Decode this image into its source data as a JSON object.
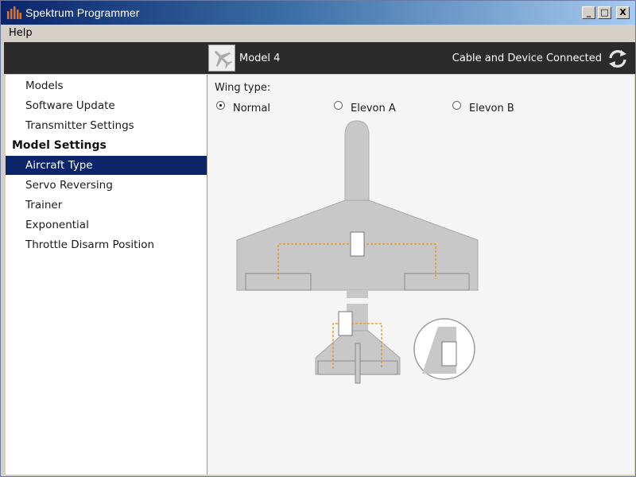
{
  "window": {
    "title": "Spektrum Programmer",
    "controls": {
      "minimize": "_",
      "maximize": "□",
      "close": "X"
    }
  },
  "menu": {
    "help": "Help"
  },
  "header": {
    "model_name": "Model 4",
    "status": "Cable and Device Connected"
  },
  "sidebar": {
    "items_top": [
      "Models",
      "Software Update",
      "Transmitter Settings"
    ],
    "section_title": "Model Settings",
    "items_model": [
      "Aircraft Type",
      "Servo Reversing",
      "Trainer",
      "Exponential",
      "Throttle Disarm Position"
    ],
    "selected": "Aircraft Type"
  },
  "main": {
    "wing_type_label": "Wing type:",
    "wing_options": [
      {
        "label": "Normal",
        "checked": true
      },
      {
        "label": "Elevon A",
        "checked": false
      },
      {
        "label": "Elevon B",
        "checked": false
      }
    ]
  },
  "colors": {
    "accent_selected": "#0b246a",
    "header_bg": "#2b2b2b",
    "servo_wire": "#f0900a",
    "airframe": "#c8c8c8",
    "app_icon": "#e8701a"
  },
  "icons": {
    "app": "spektrum-bars-icon",
    "plane": "airplane-icon",
    "refresh": "refresh-icon"
  }
}
